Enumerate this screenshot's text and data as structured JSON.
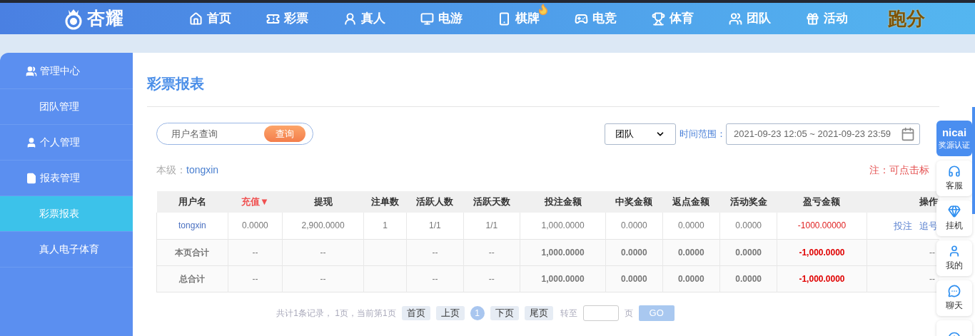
{
  "brand": {
    "name": "杏耀"
  },
  "nav": [
    {
      "label": "首页",
      "kind": "home"
    },
    {
      "label": "彩票",
      "kind": "ticket"
    },
    {
      "label": "真人",
      "kind": "person"
    },
    {
      "label": "电游",
      "kind": "slot"
    },
    {
      "label": "棋牌",
      "kind": "cards",
      "hot": true
    },
    {
      "label": "电竞",
      "kind": "gamepad"
    },
    {
      "label": "体育",
      "kind": "trophy"
    },
    {
      "label": "团队",
      "kind": "team"
    },
    {
      "label": "活动",
      "kind": "gift"
    },
    {
      "label": "跑分",
      "kind": "gold"
    }
  ],
  "sidebar": {
    "items": [
      {
        "label": "管理中心",
        "kind": "group",
        "selected": false
      },
      {
        "label": "团队管理",
        "kind": "item",
        "selected": false
      },
      {
        "label": "个人管理",
        "kind": "group",
        "selected": false
      },
      {
        "label": "报表管理",
        "kind": "group",
        "selected": false
      },
      {
        "label": "彩票报表",
        "kind": "item",
        "selected": true
      },
      {
        "label": "真人电子体育",
        "kind": "item",
        "selected": false
      }
    ]
  },
  "page": {
    "title": "彩票报表",
    "search": {
      "placeholder": "用户名查询",
      "button": "查询"
    },
    "scope_select": {
      "value": "团队"
    },
    "time_range": {
      "label": "时间范围：",
      "value": "2021-09-23 12:05 ~ 2021-09-23 23:59"
    },
    "level": {
      "label": "本级：",
      "value": "tongxin"
    },
    "note": "注：可点击标",
    "table": {
      "columns": [
        {
          "label": "用户名",
          "sorted": false
        },
        {
          "label": "充值▼",
          "sorted": true
        },
        {
          "label": "提现",
          "sorted": false
        },
        {
          "label": "注单数",
          "sorted": false
        },
        {
          "label": "活跃人数",
          "sorted": false
        },
        {
          "label": "活跃天数",
          "sorted": false
        },
        {
          "label": "投注金额",
          "sorted": false
        },
        {
          "label": "中奖金额",
          "sorted": false
        },
        {
          "label": "返点金额",
          "sorted": false
        },
        {
          "label": "活动奖金",
          "sorted": false
        },
        {
          "label": "盈亏金额",
          "sorted": false
        },
        {
          "label": "操作",
          "sorted": false
        }
      ],
      "rows": [
        {
          "kind": "data",
          "cells": [
            "tongxin",
            "0.0000",
            "2,900.0000",
            "1",
            "1/1",
            "1/1",
            "1,000.0000",
            "0.0000",
            "0.0000",
            "0.0000",
            "-1000.00000"
          ],
          "actions": [
            "投注",
            "追号"
          ]
        },
        {
          "kind": "total",
          "cells": [
            "本页合计",
            "--",
            "--",
            null,
            "--",
            "--",
            "1,000.0000",
            "0.0000",
            "0.0000",
            "0.0000",
            "-1,000.0000"
          ],
          "operation": "--"
        },
        {
          "kind": "total",
          "cells": [
            "总合计",
            "--",
            "--",
            null,
            "--",
            "--",
            "1,000.0000",
            "0.0000",
            "0.0000",
            "0.0000",
            "-1,000.0000"
          ],
          "operation": "--"
        }
      ]
    },
    "pagination": {
      "summary": "共计1条记录， 1页，当前第1页",
      "buttons": [
        "首页",
        "上页"
      ],
      "pages": [
        {
          "label": "1",
          "selected": true
        }
      ],
      "buttons_after": [
        "下页",
        "尾页"
      ],
      "goto_label": "转至",
      "goto_unit": "页",
      "go": "GO"
    }
  },
  "side_panel": {
    "badge": {
      "logo": "nicai",
      "caption": "奖源认证"
    },
    "items": [
      {
        "label": "客服",
        "kind": "headset"
      },
      {
        "label": "挂机",
        "kind": "gem"
      },
      {
        "label": "我的",
        "kind": "user"
      },
      {
        "label": "聊天",
        "kind": "chat"
      },
      {
        "kind": "alert"
      }
    ]
  }
}
